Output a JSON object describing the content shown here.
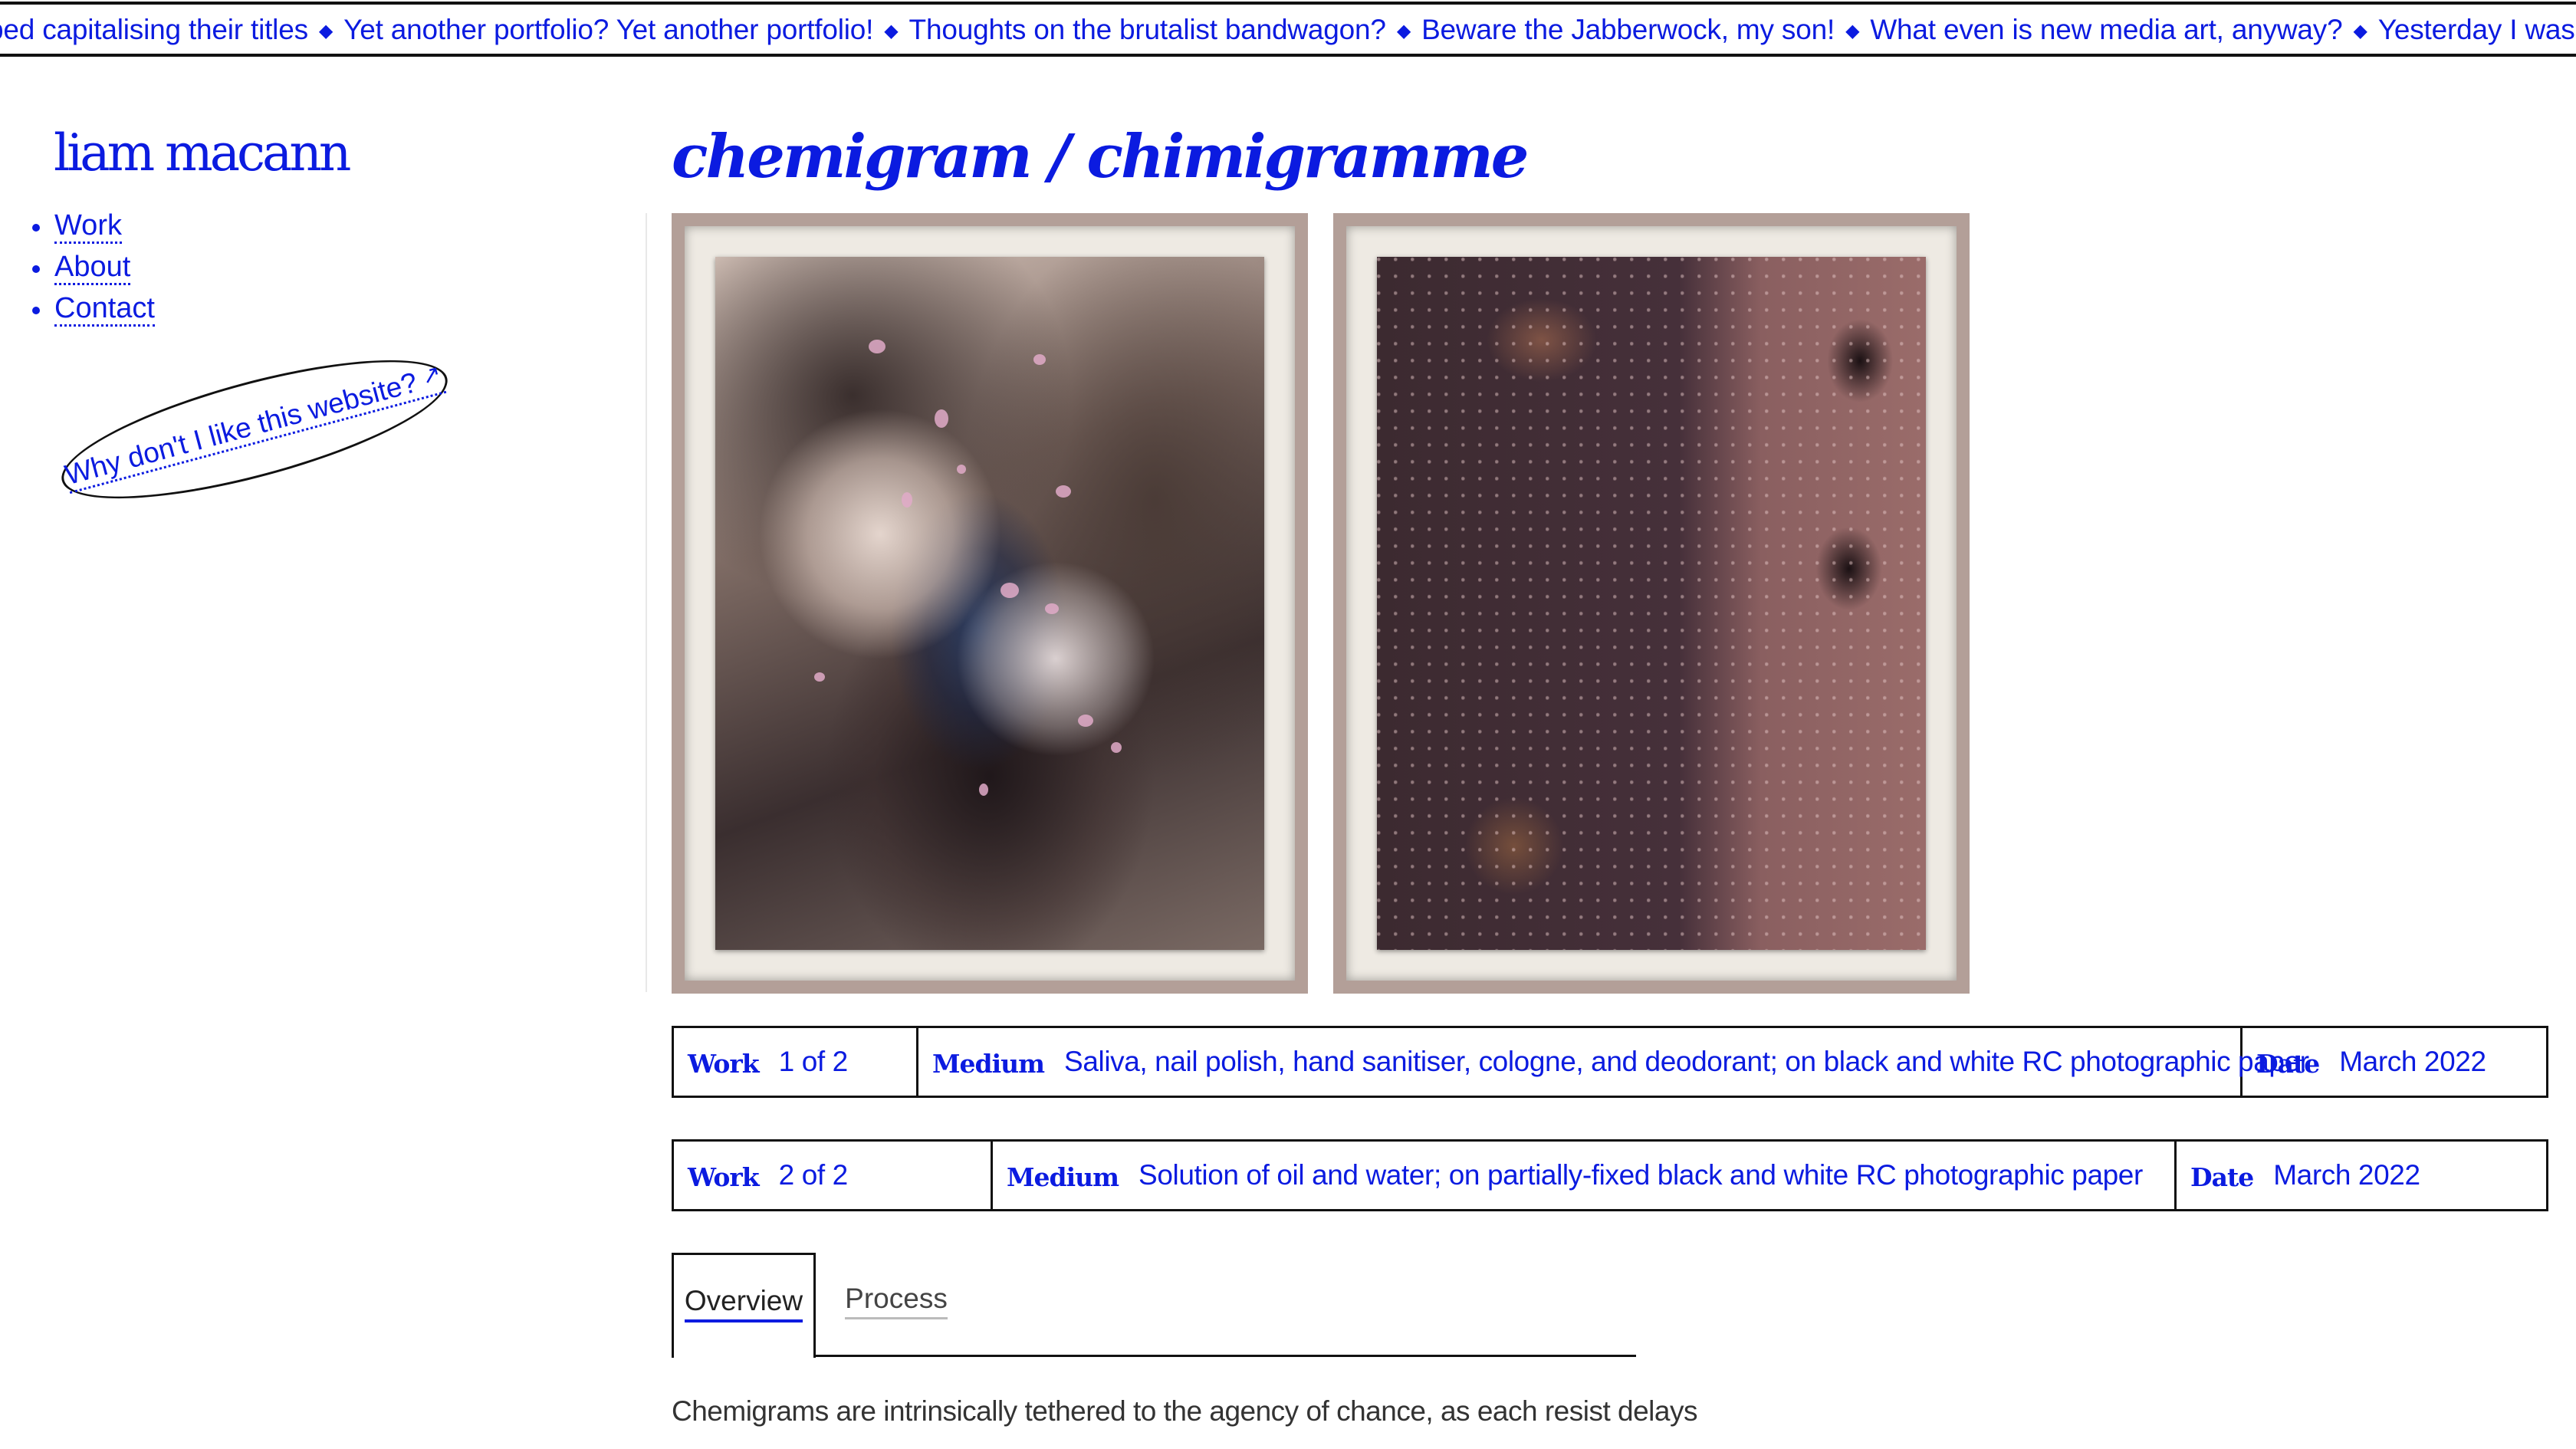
{
  "marquee": {
    "items": [
      "ped capitalising their titles",
      "Yet another portfolio? Yet another portfolio!",
      "Thoughts on the brutalist bandwagon?",
      "Beware the Jabberwock, my son!",
      "What even is new media art, anyway?",
      "Yesterday I was an ascetisist; to"
    ],
    "separator": "◆"
  },
  "site": {
    "name": "liam macann"
  },
  "nav": {
    "items": [
      "Work",
      "About",
      "Contact"
    ]
  },
  "why_link": {
    "label": "Why don't I like this website?",
    "icon": "external-arrow-icon",
    "glyph": "↗"
  },
  "page": {
    "title": "chemigram / chimigramme"
  },
  "works": [
    {
      "work_label": "Work",
      "work_value": "1 of 2",
      "medium_label": "Medium",
      "medium_value": "Saliva, nail polish, hand sanitiser, cologne, and deodorant; on black and white RC photographic paper",
      "date_label": "Date",
      "date_value": "March 2022"
    },
    {
      "work_label": "Work",
      "work_value": "2 of 2",
      "medium_label": "Medium",
      "medium_value": "Solution of oil and water; on partially-fixed black and white RC photographic paper",
      "date_label": "Date",
      "date_value": "March 2022"
    }
  ],
  "tabs": {
    "items": [
      "Overview",
      "Process"
    ],
    "active": "Overview"
  },
  "overview": {
    "text": "Chemigrams are intrinsically tethered to the agency of chance, as each resist delays"
  },
  "colors": {
    "accent": "#0b1be0",
    "border": "#111111",
    "frame": "#b39f98",
    "mat": "#eeeae3"
  }
}
